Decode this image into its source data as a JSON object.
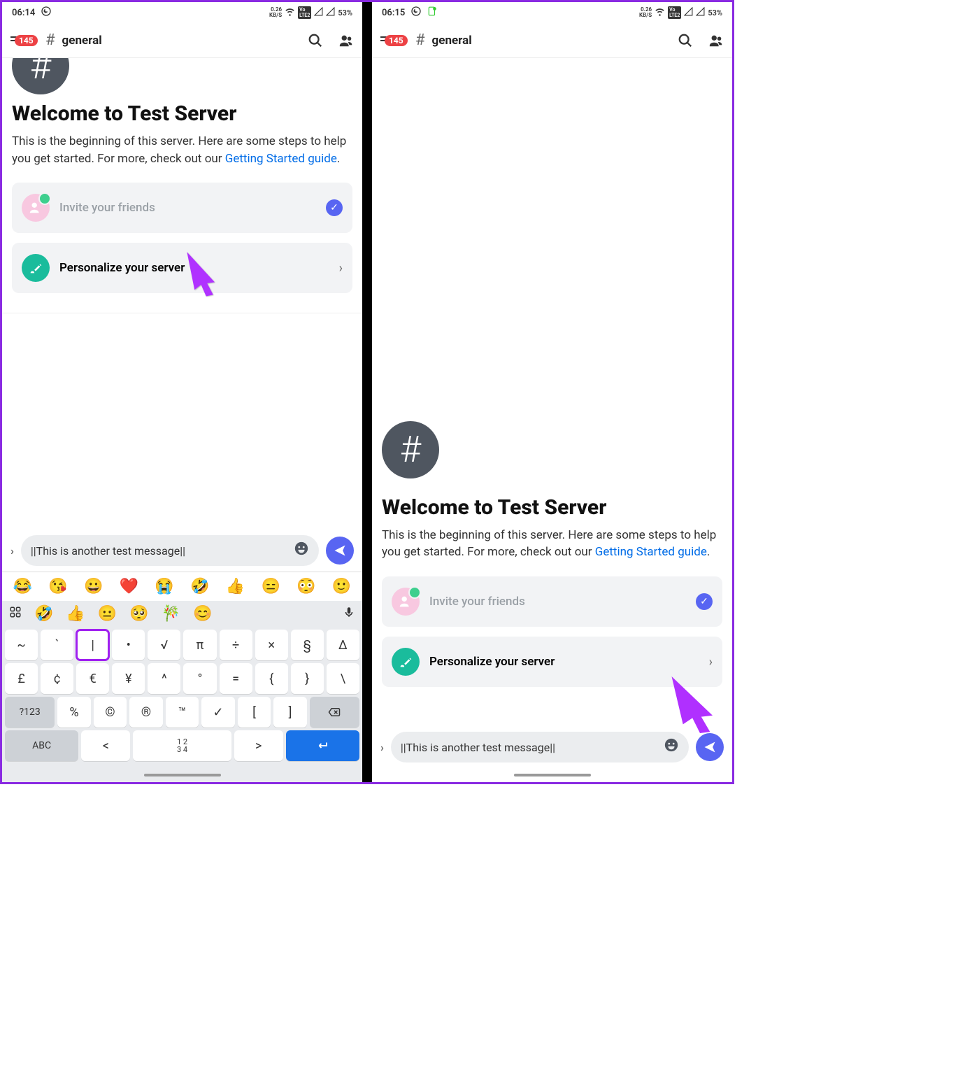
{
  "left": {
    "status": {
      "time": "06:14",
      "net": "0.26",
      "netUnit": "KB/S",
      "battery": "53%"
    },
    "header": {
      "badge": "145",
      "channel": "general"
    },
    "welcome": {
      "title": "Welcome to Test Server",
      "descPre": "This is the beginning of this server. Here are some steps to help you get started. For more, check out our ",
      "link": "Getting Started guide",
      "descPost": "."
    },
    "cards": {
      "invite": "Invite your friends",
      "personalize": "Personalize your server"
    },
    "input": {
      "text": "||This is another test message||"
    },
    "emojiRow": [
      "😂",
      "😘",
      "😀",
      "❤️",
      "😭",
      "🤣",
      "👍",
      "😑",
      "😳",
      "🙂"
    ],
    "suggRow": [
      "🤣",
      "👍",
      "😐",
      "🥺",
      "🎋",
      "😊"
    ],
    "keyRows": {
      "r1": [
        "~",
        "`",
        "|",
        "•",
        "√",
        "π",
        "÷",
        "×",
        "§",
        "Δ"
      ],
      "r2": [
        "£",
        "¢",
        "€",
        "¥",
        "^",
        "°",
        "=",
        "{",
        "}",
        "\\"
      ],
      "r3": [
        "?123",
        "%",
        "©",
        "®",
        "™",
        "✓",
        "[",
        "]",
        "⌫"
      ],
      "r4": [
        "ABC",
        "<",
        "1 2\n3 4",
        ">",
        "↵"
      ]
    }
  },
  "right": {
    "status": {
      "time": "06:15",
      "net": "0.26",
      "netUnit": "KB/S",
      "battery": "53%"
    },
    "header": {
      "badge": "145",
      "channel": "general"
    },
    "welcome": {
      "title": "Welcome to Test Server",
      "descPre": "This is the beginning of this server. Here are some steps to help you get started. For more, check out our ",
      "link": "Getting Started guide",
      "descPost": "."
    },
    "cards": {
      "invite": "Invite your friends",
      "personalize": "Personalize your server"
    },
    "input": {
      "text": "||This is another test message||"
    }
  }
}
